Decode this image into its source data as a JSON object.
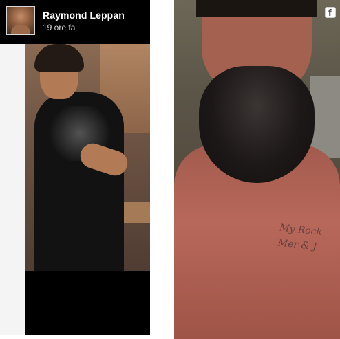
{
  "post": {
    "author_name": "Raymond Leppan",
    "timestamp": "19 ore fa"
  },
  "badge": {
    "letter": "f"
  },
  "tattoo": {
    "line1": "My Rock",
    "line2": "Mer & J"
  },
  "icons": {
    "avatar": "profile-photo",
    "facebook": "facebook-logo-icon"
  },
  "colors": {
    "panel_background": "#000000",
    "page_background": "#ffffff",
    "name_text": "#ffffff",
    "timestamp_text": "#dcdcdc"
  }
}
